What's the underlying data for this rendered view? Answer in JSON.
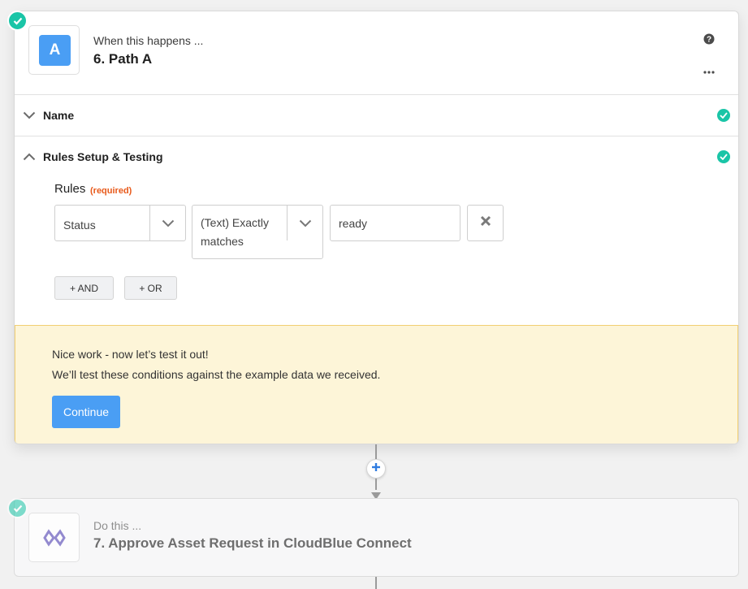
{
  "step_trigger": {
    "app_letter": "A",
    "subtitle": "When this happens ...",
    "title": "6. Path A",
    "help_icon": "question-circle-icon",
    "more_icon": "ellipsis-icon"
  },
  "sections": {
    "name_label": "Name",
    "rules_label": "Rules Setup & Testing"
  },
  "rules": {
    "heading": "Rules",
    "required_tag": "(required)",
    "field_value": "Status",
    "operator_value": "(Text) Exactly matches",
    "input_value": "ready",
    "and_button": "+ AND",
    "or_button": "+ OR"
  },
  "notice": {
    "line1": "Nice work - now let’s test it out!",
    "line2": "We’ll test these conditions against the example data we received.",
    "continue_label": "Continue"
  },
  "step_action": {
    "subtitle": "Do this ...",
    "title": "7. Approve Asset Request in CloudBlue Connect",
    "app_icon": "cloudblue-connect-logo-icon"
  },
  "colors": {
    "accent_blue": "#4a9ef4",
    "success_green": "#1ac5a7",
    "required_orange": "#e8591a",
    "notice_bg": "#fdf5d8",
    "notice_border": "#f2cf72",
    "cloudblue_purple": "#7b6fc6"
  }
}
